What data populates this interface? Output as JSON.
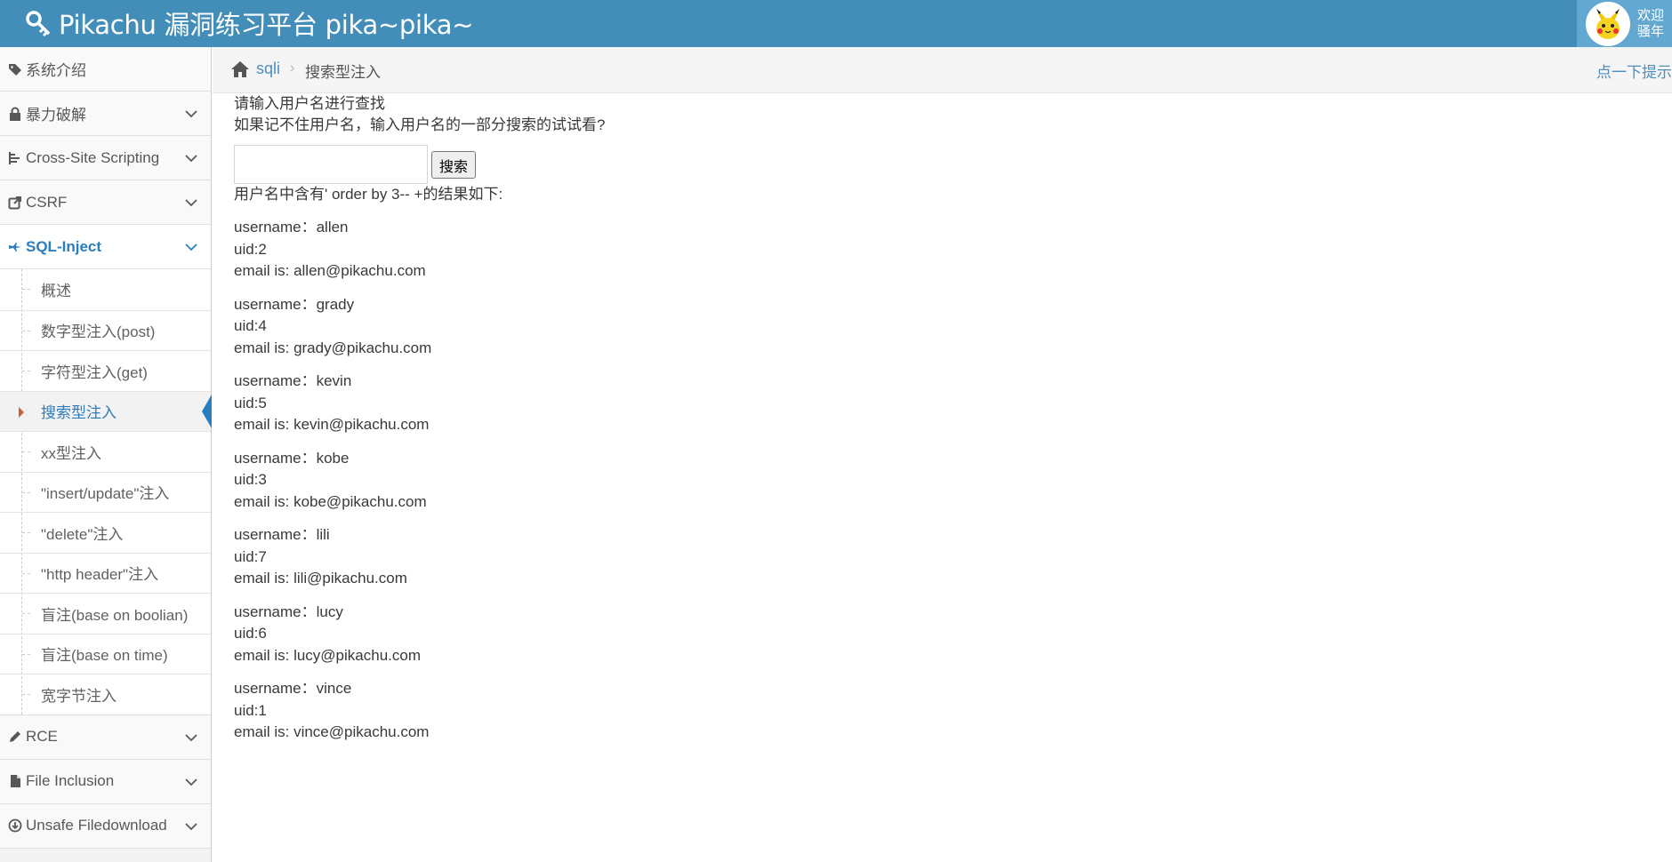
{
  "header": {
    "title": "Pikachu 漏洞练习平台 pika~pika~",
    "welcome": "欢迎",
    "username": "骚年"
  },
  "sidebar": {
    "items": [
      {
        "label": "系统介绍",
        "icon": "tags-icon",
        "chevron": false
      },
      {
        "label": "暴力破解",
        "icon": "lock-icon",
        "chevron": true
      },
      {
        "label": "Cross-Site Scripting",
        "icon": "list-tree-icon",
        "chevron": true
      },
      {
        "label": "CSRF",
        "icon": "share-icon",
        "chevron": true
      },
      {
        "label": "SQL-Inject",
        "icon": "fighter-jet-icon",
        "chevron": true,
        "open": true
      }
    ],
    "submenu": [
      "概述",
      "数字型注入(post)",
      "字符型注入(get)",
      "搜索型注入",
      "xx型注入",
      "\"insert/update\"注入",
      "\"delete\"注入",
      "\"http header\"注入",
      "盲注(base on boolian)",
      "盲注(base on time)",
      "宽字节注入"
    ],
    "active_submenu": "搜索型注入",
    "bottom_items": [
      {
        "label": "RCE",
        "icon": "pencil-icon"
      },
      {
        "label": "File Inclusion",
        "icon": "file-icon"
      },
      {
        "label": "Unsafe Filedownload",
        "icon": "download-icon"
      }
    ]
  },
  "breadcrumb": {
    "link": "sqli",
    "current": "搜索型注入",
    "hint": "点一下提示~"
  },
  "main": {
    "prompt_1": "请输入用户名进行查找",
    "prompt_2": "如果记不住用户名，输入用户名的一部分搜索的试试看?",
    "search_value": "",
    "search_button": "搜索",
    "result_heading": "用户名中含有' order by 3-- +的结果如下:",
    "records": [
      {
        "username": "username：allen",
        "uid": "uid:2",
        "email": "email is: allen@pikachu.com"
      },
      {
        "username": "username：grady",
        "uid": "uid:4",
        "email": "email is: grady@pikachu.com"
      },
      {
        "username": "username：kevin",
        "uid": "uid:5",
        "email": "email is: kevin@pikachu.com"
      },
      {
        "username": "username：kobe",
        "uid": "uid:3",
        "email": "email is: kobe@pikachu.com"
      },
      {
        "username": "username：lili",
        "uid": "uid:7",
        "email": "email is: lili@pikachu.com"
      },
      {
        "username": "username：lucy",
        "uid": "uid:6",
        "email": "email is: lucy@pikachu.com"
      },
      {
        "username": "username：vince",
        "uid": "uid:1",
        "email": "email is: vince@pikachu.com"
      }
    ]
  },
  "colors": {
    "navbar": "#438eb9",
    "accent": "#2b7dbc",
    "link": "#4c8fbd"
  }
}
